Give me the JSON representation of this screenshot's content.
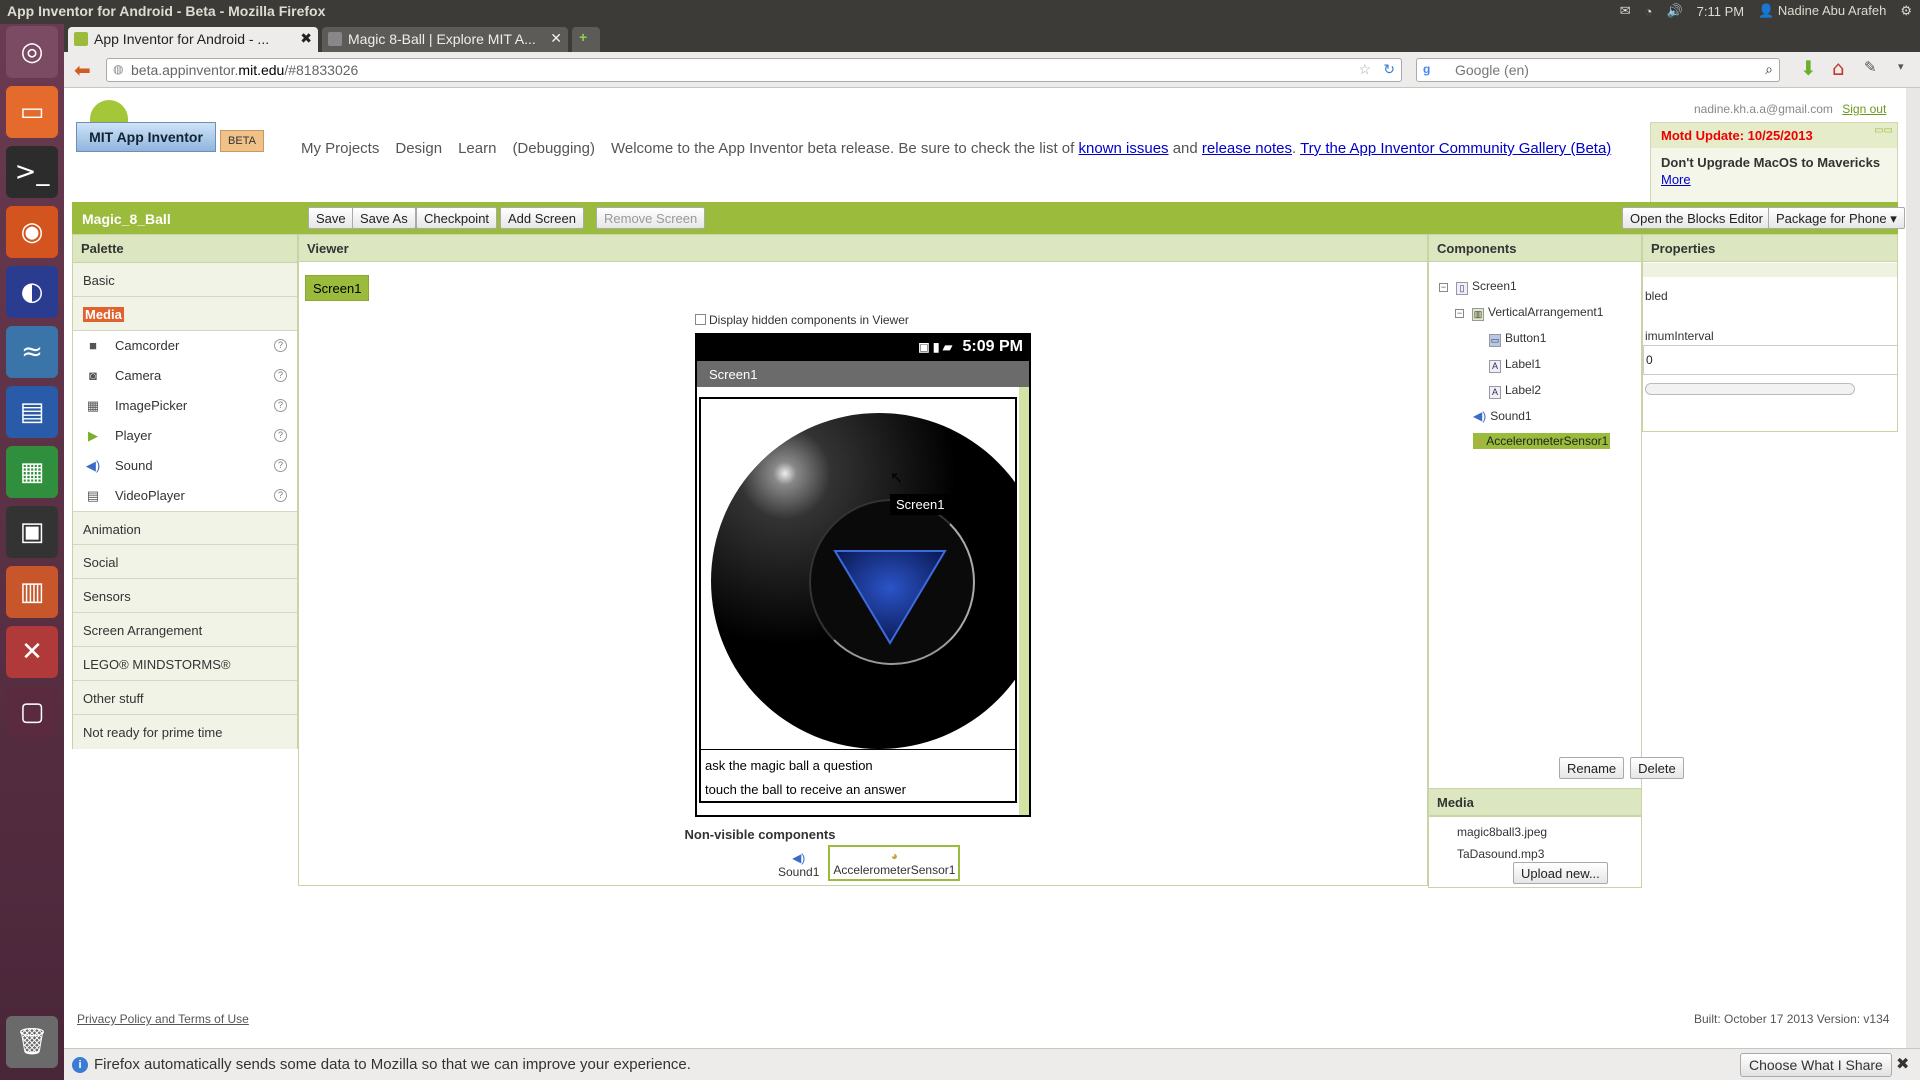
{
  "os": {
    "window_title": "App Inventor for Android - Beta - Mozilla Firefox",
    "time": "7:11 PM",
    "user": "Nadine Abu Arafeh"
  },
  "browser": {
    "tabs": [
      {
        "label": "App Inventor for Android - ..."
      },
      {
        "label": "Magic 8-Ball | Explore MIT A..."
      }
    ],
    "url_host": "beta.appinventor.",
    "url_bold": "mit.edu",
    "url_rest": "/#81833026",
    "search_placeholder": "Google (en)"
  },
  "header": {
    "logo_text": "MIT App Inventor",
    "beta_badge": "BETA",
    "nav": [
      "My Projects",
      "Design",
      "Learn",
      "(Debugging)"
    ],
    "welcome_prefix": "Welcome to the App Inventor beta release. Be sure to check the list of",
    "known_issues": "known issues",
    "and": "and",
    "release_notes": "release notes",
    "gallery_link": "Try the App Inventor Community Gallery (Beta)",
    "account_email": "nadine.kh.a.a@gmail.com",
    "sign_out": "Sign out"
  },
  "motd": {
    "title": "Motd Update: 10/25/2013",
    "body": "Don't Upgrade MacOS to Mavericks",
    "more": "More"
  },
  "toolbar": {
    "project_name": "Magic_8_Ball",
    "save": "Save",
    "save_as": "Save As",
    "checkpoint": "Checkpoint",
    "add_screen": "Add Screen",
    "remove_screen": "Remove Screen",
    "open_blocks": "Open the Blocks Editor",
    "package": "Package for Phone ▾"
  },
  "palette": {
    "title": "Palette",
    "categories_before": [
      "Basic"
    ],
    "selected": "Media",
    "items": [
      {
        "label": "Camcorder",
        "icon": "📹"
      },
      {
        "label": "Camera",
        "icon": "📷"
      },
      {
        "label": "ImagePicker",
        "icon": "▦"
      },
      {
        "label": "Player",
        "icon": "▶"
      },
      {
        "label": "Sound",
        "icon": "🔉"
      },
      {
        "label": "VideoPlayer",
        "icon": "▤"
      }
    ],
    "categories_after": [
      "Animation",
      "Social",
      "Sensors",
      "Screen Arrangement",
      "LEGO® MINDSTORMS®",
      "Other stuff",
      "Not ready for prime time"
    ],
    "help": "?"
  },
  "viewer": {
    "title": "Viewer",
    "screen_tab": "Screen1",
    "hidden_checkbox": "Display hidden components in Viewer",
    "phone_time": "5:09 PM",
    "phone_title": "Screen1",
    "tooltip": "Screen1",
    "label1": "ask the magic ball a question",
    "label2": "touch the ball to receive an answer",
    "nonvisible_title": "Non-visible components",
    "nonvisible": [
      "Sound1",
      "AccelerometerSensor1"
    ]
  },
  "components": {
    "title": "Components",
    "tree": [
      "Screen1",
      "VerticalArrangement1",
      "Button1",
      "Label1",
      "Label2",
      "Sound1",
      "AccelerometerSensor1"
    ],
    "rename": "Rename",
    "delete": "Delete"
  },
  "media": {
    "title": "Media",
    "files": [
      "magic8ball3.jpeg",
      "TaDasound.mp3"
    ],
    "upload": "Upload new..."
  },
  "properties": {
    "title": "Properties",
    "prop1": "bled",
    "prop2": "imumInterval",
    "prop2_value": "0"
  },
  "footer": {
    "privacy": "Privacy Policy and Terms of Use",
    "built": "Built: October 17 2013 Version: v134"
  },
  "notification": {
    "message": "Firefox automatically sends some data to Mozilla so that we can improve your experience.",
    "button": "Choose What I Share"
  }
}
